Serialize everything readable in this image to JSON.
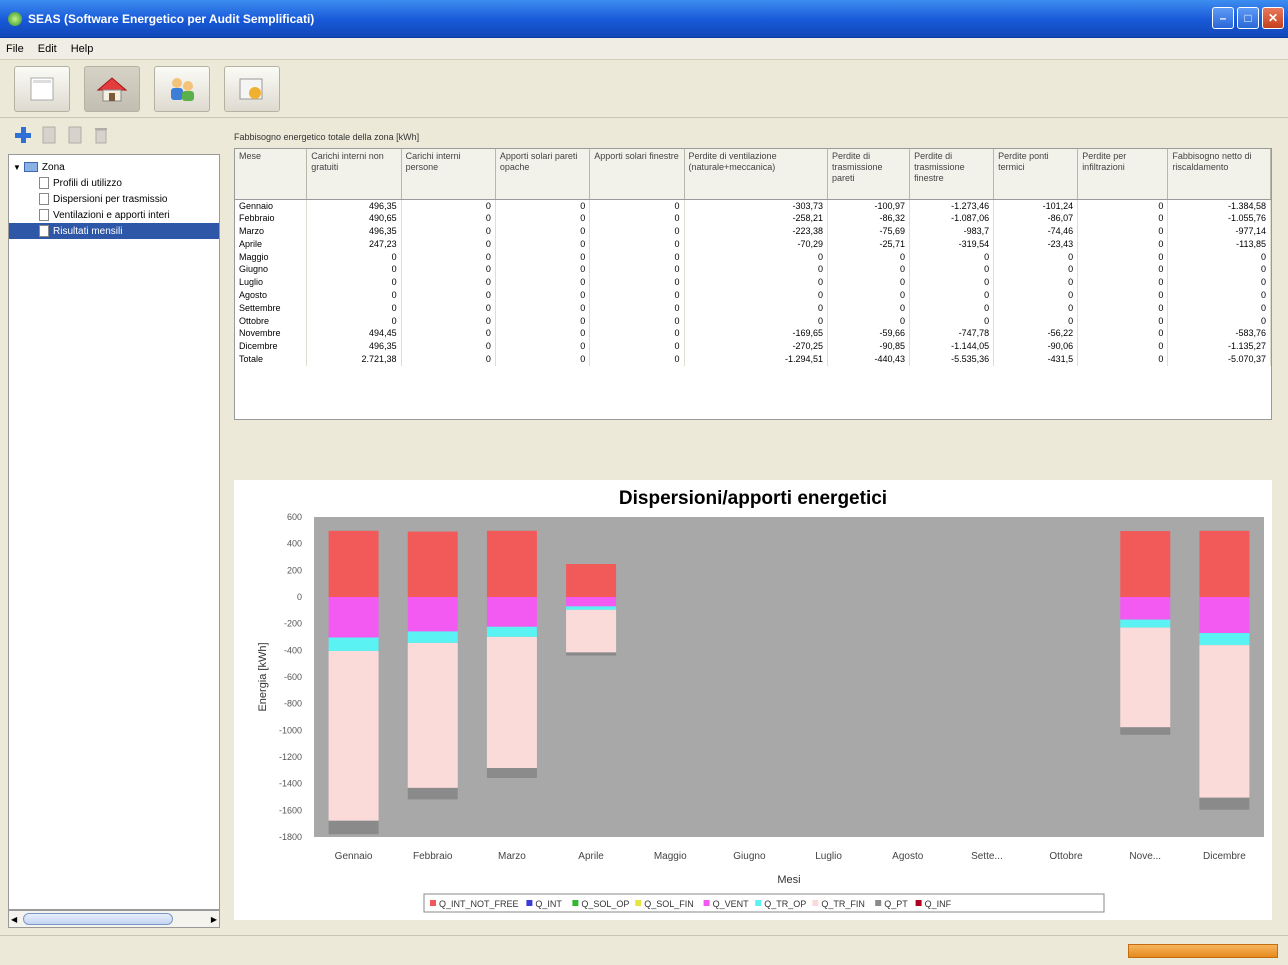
{
  "window": {
    "title": "SEAS (Software Energetico per Audit Semplificati)"
  },
  "menu": [
    "File",
    "Edit",
    "Help"
  ],
  "toolbar": {
    "buttons": [
      "document-icon",
      "home-icon",
      "people-icon",
      "chart-icon"
    ]
  },
  "tree": {
    "root": "Zona",
    "items": [
      "Profili di utilizzo",
      "Dispersioni per trasmissio",
      "Ventilazioni e apporti interi",
      "Risultati mensili"
    ]
  },
  "table": {
    "title": "Fabbisogno energetico totale della zona [kWh]",
    "headers": [
      "Mese",
      "Carichi interni non gratuiti",
      "Carichi interni persone",
      "Apporti solari pareti opache",
      "Apporti solari finestre",
      "Perdite di ventilazione (naturale+meccanica)",
      "Perdite di trasmissione pareti",
      "Perdite di trasmissione finestre",
      "Perdite ponti termici",
      "Perdite per infiltrazioni",
      "Fabbisogno netto di riscaldamento"
    ],
    "rows": [
      [
        "Gennaio",
        "496,35",
        "0",
        "0",
        "0",
        "-303,73",
        "-100,97",
        "-1.273,46",
        "-101,24",
        "0",
        "-1.384,58"
      ],
      [
        "Febbraio",
        "490,65",
        "0",
        "0",
        "0",
        "-258,21",
        "-86,32",
        "-1.087,06",
        "-86,07",
        "0",
        "-1.055,76"
      ],
      [
        "Marzo",
        "496,35",
        "0",
        "0",
        "0",
        "-223,38",
        "-75,69",
        "-983,7",
        "-74,46",
        "0",
        "-977,14"
      ],
      [
        "Aprile",
        "247,23",
        "0",
        "0",
        "0",
        "-70,29",
        "-25,71",
        "-319,54",
        "-23,43",
        "0",
        "-113,85"
      ],
      [
        "Maggio",
        "0",
        "0",
        "0",
        "0",
        "0",
        "0",
        "0",
        "0",
        "0",
        "0"
      ],
      [
        "Giugno",
        "0",
        "0",
        "0",
        "0",
        "0",
        "0",
        "0",
        "0",
        "0",
        "0"
      ],
      [
        "Luglio",
        "0",
        "0",
        "0",
        "0",
        "0",
        "0",
        "0",
        "0",
        "0",
        "0"
      ],
      [
        "Agosto",
        "0",
        "0",
        "0",
        "0",
        "0",
        "0",
        "0",
        "0",
        "0",
        "0"
      ],
      [
        "Settembre",
        "0",
        "0",
        "0",
        "0",
        "0",
        "0",
        "0",
        "0",
        "0",
        "0"
      ],
      [
        "Ottobre",
        "0",
        "0",
        "0",
        "0",
        "0",
        "0",
        "0",
        "0",
        "0",
        "0"
      ],
      [
        "Novembre",
        "494,45",
        "0",
        "0",
        "0",
        "-169,65",
        "-59,66",
        "-747,78",
        "-56,22",
        "0",
        "-583,76"
      ],
      [
        "Dicembre",
        "496,35",
        "0",
        "0",
        "0",
        "-270,25",
        "-90,85",
        "-1.144,05",
        "-90,06",
        "0",
        "-1.135,27"
      ],
      [
        "Totale",
        "2.721,38",
        "0",
        "0",
        "0",
        "-1.294,51",
        "-440,43",
        "-5.535,36",
        "-431,5",
        "0",
        "-5.070,37"
      ]
    ]
  },
  "chart_data": {
    "type": "bar",
    "title": "Dispersioni/apporti energetici",
    "xlabel": "Mesi",
    "ylabel": "Energia [kWh]",
    "ylim": [
      -1800,
      600
    ],
    "yticks": [
      600,
      400,
      200,
      0,
      -200,
      -400,
      -600,
      -800,
      -1000,
      -1200,
      -1400,
      -1600,
      -1800
    ],
    "categories": [
      "Gennaio",
      "Febbraio",
      "Marzo",
      "Aprile",
      "Maggio",
      "Giugno",
      "Luglio",
      "Agosto",
      "Sette...",
      "Ottobre",
      "Nove...",
      "Dicembre"
    ],
    "stacked": true,
    "series": [
      {
        "name": "Q_INT_NOT_FREE",
        "color": "#f25a5a",
        "values": [
          496.35,
          490.65,
          496.35,
          247.23,
          0,
          0,
          0,
          0,
          0,
          0,
          494.45,
          496.35
        ]
      },
      {
        "name": "Q_INT",
        "color": "#3b3bd9",
        "values": [
          0,
          0,
          0,
          0,
          0,
          0,
          0,
          0,
          0,
          0,
          0,
          0
        ]
      },
      {
        "name": "Q_SOL_OP",
        "color": "#31b731",
        "values": [
          0,
          0,
          0,
          0,
          0,
          0,
          0,
          0,
          0,
          0,
          0,
          0
        ]
      },
      {
        "name": "Q_SOL_FIN",
        "color": "#e6e640",
        "values": [
          0,
          0,
          0,
          0,
          0,
          0,
          0,
          0,
          0,
          0,
          0,
          0
        ]
      },
      {
        "name": "Q_VENT",
        "color": "#f25af2",
        "values": [
          -303.73,
          -258.21,
          -223.38,
          -70.29,
          0,
          0,
          0,
          0,
          0,
          0,
          -169.65,
          -270.25
        ]
      },
      {
        "name": "Q_TR_OP",
        "color": "#5af2f2",
        "values": [
          -100.97,
          -86.32,
          -75.69,
          -25.71,
          0,
          0,
          0,
          0,
          0,
          0,
          -59.66,
          -90.85
        ]
      },
      {
        "name": "Q_TR_FIN",
        "color": "#fbdada",
        "values": [
          -1273.46,
          -1087.06,
          -983.7,
          -319.54,
          0,
          0,
          0,
          0,
          0,
          0,
          -747.78,
          -1144.05
        ]
      },
      {
        "name": "Q_PT",
        "color": "#8a8a8a",
        "values": [
          -101.24,
          -86.07,
          -74.46,
          -23.43,
          0,
          0,
          0,
          0,
          0,
          0,
          -56.22,
          -90.06
        ]
      },
      {
        "name": "Q_INF",
        "color": "#b00020",
        "values": [
          0,
          0,
          0,
          0,
          0,
          0,
          0,
          0,
          0,
          0,
          0,
          0
        ]
      }
    ],
    "legend": "bottom"
  }
}
